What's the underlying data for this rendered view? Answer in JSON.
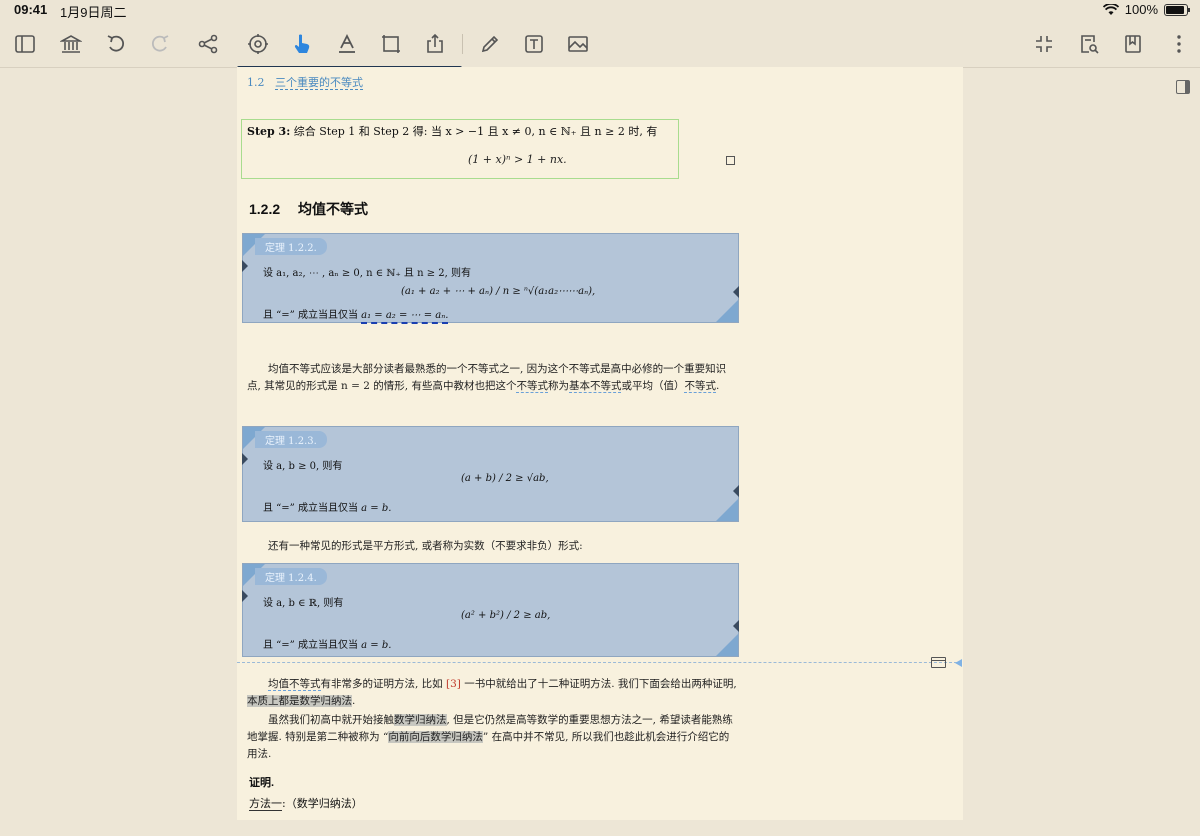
{
  "status": {
    "time": "09:41",
    "date": "1月9日周二",
    "battery": "100%"
  },
  "toolbar": {
    "icons": [
      "sidebar-icon",
      "library-icon",
      "undo-icon",
      "redo-icon",
      "mindmap-icon",
      "settings-wheel-icon",
      "pointer-hand-icon",
      "text-highlight-icon",
      "crop-icon",
      "export-icon",
      "pen-icon",
      "textbox-icon",
      "image-icon",
      "fullscreen-icon",
      "search-document-icon",
      "bookmark-icon",
      "more-icon"
    ],
    "active": "pointer-hand-icon"
  },
  "page": {
    "running_head_num": "1.2",
    "running_head_title": "三个重要的不等式",
    "step3_label": "Step 3:",
    "step3_text": "综合 Step 1 和 Step 2 得: 当 x > −1 且 x ≠ 0, n ∈ ℕ₊ 且 n ≥ 2 时, 有",
    "step3_formula": "(1 + x)ⁿ > 1 + nx.",
    "section_num": "1.2.2",
    "section_title": "均值不等式",
    "theorems": [
      {
        "tag": "定理 1.2.2.",
        "line": "设 a₁, a₂, ⋯ , aₙ ≥ 0, n ∈ ℕ₊ 且 n ≥ 2, 则有",
        "formula": "(a₁ + a₂ + ⋯ + aₙ) / n ≥ ⁿ√(a₁a₂⋯⋯aₙ),",
        "eq_prefix": "且 “=” 成立当且仅当 ",
        "eq_cond": "a₁ = a₂ = ⋯ = aₙ."
      },
      {
        "tag": "定理 1.2.3.",
        "line": "设 a, b ≥ 0, 则有",
        "formula": "(a + b) / 2 ≥ √ab,",
        "eq_prefix": "且 “=” 成立当且仅当 ",
        "eq_cond": "a = b."
      },
      {
        "tag": "定理 1.2.4.",
        "line": "设 a, b ∈ ℝ, 则有",
        "formula": "(a² + b²) / 2 ≥ ab,",
        "eq_prefix": "且 “=” 成立当且仅当 ",
        "eq_cond": "a = b."
      }
    ],
    "para1": {
      "a": "均值不等式应该是大部分读者最熟悉的一个不等式之一, 因为这个不等式是高中必修的一个重要知识点, 其常见的形式是 n = 2 的情形, 有些高中教材也把这个",
      "b": "不等式",
      "c": "称为",
      "d": "基本不等式",
      "e": "或平均（值）",
      "f": "不等式",
      "g": "."
    },
    "para2": "还有一种常见的形式是平方形式, 或者称为实数（不要求非负）形式:",
    "para3": {
      "a": "均值不等式",
      "b": "有非常多的证明方法, 比如 ",
      "ref": "[3]",
      "c": " 一书中就给出了十二种证明方法. 我们下面会给出两种证明, ",
      "d": "本质上都是数学归纳法",
      "e": "."
    },
    "para4": {
      "a": "虽然我们初高中就开始接触",
      "b": "数学归纳法",
      "c": ", 但是它仍然是高等数学的重要思想方法之一, 希望读者能熟练地掌握. 特别是第二种被称为 “",
      "d": "向前向后数学归纳法",
      "e": "” 在高中并不常见, 所以我们也趁此机会进行介绍它的用法."
    },
    "proof_label": "证明.",
    "method_label": "方法一",
    "method_text": ":（数学归纳法）"
  }
}
